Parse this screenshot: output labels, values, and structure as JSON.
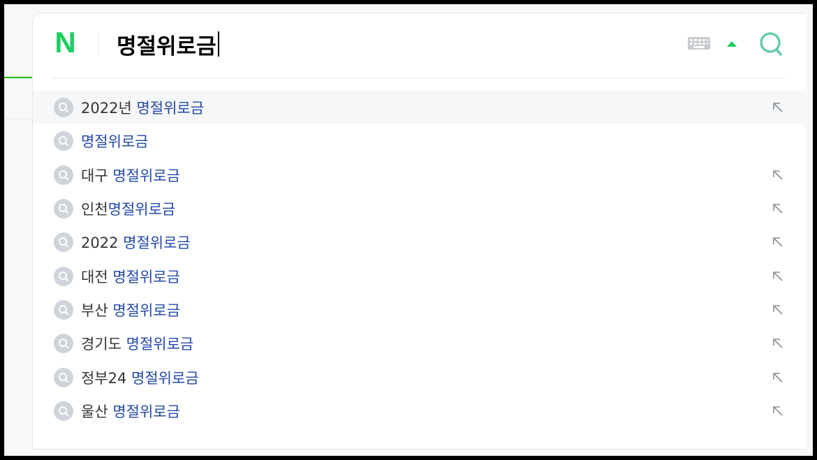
{
  "search": {
    "query": "명절위로금"
  },
  "suggestions": [
    {
      "prefix": "2022년 ",
      "highlight": "명절위로금",
      "has_fill": true,
      "active": true
    },
    {
      "prefix": "",
      "highlight": "명절위로금",
      "has_fill": false,
      "active": false
    },
    {
      "prefix": "대구 ",
      "highlight": "명절위로금",
      "has_fill": true,
      "active": false
    },
    {
      "prefix": "인천",
      "highlight": "명절위로금",
      "has_fill": true,
      "active": false
    },
    {
      "prefix": "2022 ",
      "highlight": "명절위로금",
      "has_fill": true,
      "active": false
    },
    {
      "prefix": "대전 ",
      "highlight": "명절위로금",
      "has_fill": true,
      "active": false
    },
    {
      "prefix": "부산 ",
      "highlight": "명절위로금",
      "has_fill": true,
      "active": false
    },
    {
      "prefix": "경기도 ",
      "highlight": "명절위로금",
      "has_fill": true,
      "active": false
    },
    {
      "prefix": "정부24 ",
      "highlight": "명절위로금",
      "has_fill": true,
      "active": false
    },
    {
      "prefix": "울산 ",
      "highlight": "명절위로금",
      "has_fill": true,
      "active": false
    }
  ],
  "logo": {
    "text": "N"
  },
  "icons": {
    "logo": "naver-n-logo",
    "keyboard": "keyboard-icon",
    "toggle": "arrow-up-icon",
    "search": "search-icon",
    "suggestion": "search-icon",
    "fill": "arrow-up-left-icon"
  },
  "colors": {
    "brand_green": "#19ce60",
    "highlight_blue": "#2147a8",
    "search_teal": "#5fc9a6"
  }
}
